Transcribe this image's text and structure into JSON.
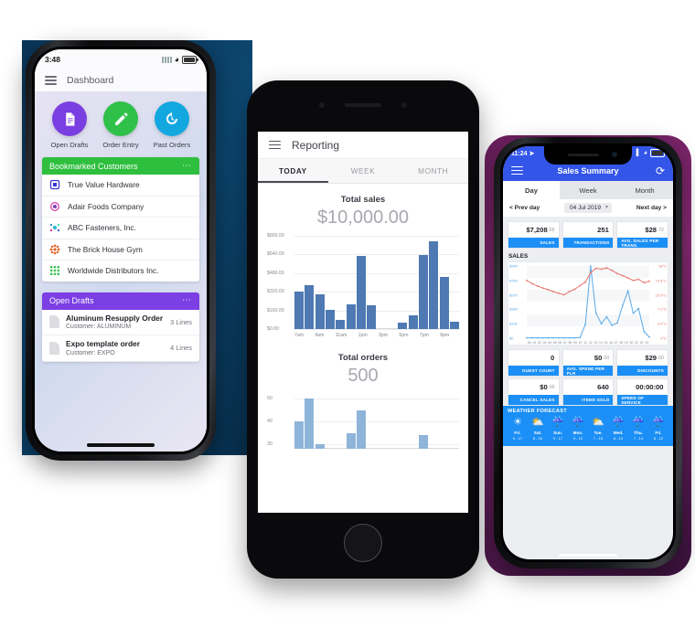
{
  "phone1": {
    "status": {
      "time": "3:48",
      "wifi_icon": "wifi-icon",
      "battery_icon": "battery-icon",
      "signal_icon": "signal-icon"
    },
    "appbar": {
      "menu_icon": "hamburger-menu-icon",
      "title": "Dashboard"
    },
    "actions": [
      {
        "label": "Open Drafts",
        "color": "#7a3fe0",
        "icon": "document-icon"
      },
      {
        "label": "Order Entry",
        "color": "#2fc04a",
        "icon": "pencil-icon"
      },
      {
        "label": "Past Orders",
        "color": "#13a7e0",
        "icon": "history-icon"
      }
    ],
    "bookmarked": {
      "title": "Bookmarked Customers",
      "color": "#2fbf3f",
      "overflow_icon": "more-options-icon",
      "customers": [
        {
          "name": "True Value Hardware",
          "color": "#3a35d8"
        },
        {
          "name": "Adair Foods Company",
          "color": "#d93fb0"
        },
        {
          "name": "ABC Fasteners, Inc.",
          "color": "#2fb7d8"
        },
        {
          "name": "The Brick House Gym",
          "color": "#e06428"
        },
        {
          "name": "Worldwide Distributors Inc.",
          "color": "#3fc45a"
        }
      ]
    },
    "drafts": {
      "title": "Open Drafts",
      "color": "#7b3fe4",
      "overflow_icon": "more-options-icon",
      "items": [
        {
          "title": "Aluminum Resupply Order",
          "subtitle": "Customer: ALUMINUM",
          "lines": "3 Lines"
        },
        {
          "title": "Expo template order",
          "subtitle": "Customer: EXPO",
          "lines": "4 Lines"
        }
      ]
    }
  },
  "phone2": {
    "appbar": {
      "menu_icon": "hamburger-menu-icon",
      "title": "Reporting"
    },
    "tabs": [
      {
        "label": "TODAY",
        "active": true
      },
      {
        "label": "WEEK",
        "active": false
      },
      {
        "label": "MONTH",
        "active": false
      }
    ],
    "sales_title": "Total sales",
    "sales_value": "$10,000.00",
    "orders_title": "Total orders",
    "orders_value": "500"
  },
  "phone3": {
    "status": {
      "time": "11:24",
      "location_icon": "location-arrow-icon",
      "signal_icon": "signal-icon",
      "wifi_icon": "wifi-icon",
      "battery_icon": "battery-icon"
    },
    "appbar": {
      "menu_icon": "hamburger-menu-icon",
      "title": "Sales Summary",
      "refresh_icon": "refresh-icon"
    },
    "segments": [
      {
        "label": "Day",
        "active": true
      },
      {
        "label": "Week",
        "active": false
      },
      {
        "label": "Month",
        "active": false
      }
    ],
    "daynav": {
      "prev": "< Prev day",
      "date": "04 Jul 2019",
      "next": "Next day >",
      "dropdown_icon": "chevron-down-icon"
    },
    "tiles_top": [
      {
        "value": "$7,208",
        "cents": ".65",
        "key": "SALES"
      },
      {
        "value": "251",
        "cents": "",
        "key": "TRANSACTIONS"
      },
      {
        "value": "$28",
        "cents": ".72",
        "key": "AVG. SALES PER TRANS."
      }
    ],
    "tiles_bottom": [
      {
        "value": "0",
        "cents": "",
        "key": "GUEST COUNT"
      },
      {
        "value": "$0",
        "cents": ".00",
        "key": "AVG. SPEND PER PLR"
      },
      {
        "value": "$29",
        "cents": ".00",
        "key": "DISCOUNTS"
      },
      {
        "value": "$0",
        "cents": ".00",
        "key": "CANCEL SALES"
      },
      {
        "value": "640",
        "cents": "",
        "key": "ITEMS SOLD"
      },
      {
        "value": "00:00:00",
        "cents": "",
        "key": "SPEED OF SERVICE"
      }
    ],
    "sales_section": "SALES",
    "weather_title": "WEATHER FORECAST",
    "weather": [
      {
        "day": "Fri.",
        "temps": "5 - 17",
        "icon": "sun-icon"
      },
      {
        "day": "Sat.",
        "temps": "8 - 18",
        "icon": "partly-cloudy-icon"
      },
      {
        "day": "Sun.",
        "temps": "9 - 17",
        "icon": "rain-icon"
      },
      {
        "day": "Mon.",
        "temps": "9 - 15",
        "icon": "rain-icon"
      },
      {
        "day": "Tue.",
        "temps": "7 - 15",
        "icon": "partly-cloudy-icon"
      },
      {
        "day": "Wed.",
        "temps": "8 - 13",
        "icon": "rain-icon"
      },
      {
        "day": "Thu.",
        "temps": "7 - 14",
        "icon": "rain-icon"
      },
      {
        "day": "Fri.",
        "temps": "8 - 12",
        "icon": "rain-icon"
      }
    ]
  },
  "chart_data": [
    {
      "type": "bar",
      "title": "Total sales",
      "subtitle": "$10,000.00",
      "xlabel": "",
      "ylabel": "",
      "ylim": [
        0,
        800
      ],
      "ytick_labels": [
        "$0.00",
        "$160.00",
        "$320.00",
        "$480.00",
        "$640.00",
        "$800.00"
      ],
      "ytick_values": [
        0,
        160,
        320,
        480,
        640,
        800
      ],
      "grid": true,
      "categories": [
        "7am",
        "8am",
        "9am",
        "10am",
        "11am",
        "12pm",
        "1pm",
        "2pm",
        "3pm",
        "4pm",
        "5pm",
        "6pm",
        "7pm",
        "8pm",
        "9pm",
        "10pm"
      ],
      "xtick_labels": [
        "7am",
        "",
        "9am",
        "",
        "11am",
        "",
        "1pm",
        "",
        "3pm",
        "",
        "5pm",
        "",
        "7pm",
        "",
        "9pm",
        ""
      ],
      "values": [
        320,
        375,
        300,
        165,
        80,
        215,
        625,
        205,
        0,
        0,
        55,
        120,
        635,
        750,
        450,
        65
      ],
      "color": "#4e79b2"
    },
    {
      "type": "bar",
      "title": "Total orders",
      "subtitle": "500",
      "xlabel": "",
      "ylabel": "",
      "ylim": [
        28,
        52
      ],
      "ytick_labels": [
        "30",
        "40",
        "50"
      ],
      "ytick_values": [
        30,
        40,
        50
      ],
      "grid": true,
      "categories": [
        "7am",
        "8am",
        "9am",
        "10am",
        "11am",
        "12pm",
        "1pm",
        "2pm",
        "3pm",
        "4pm",
        "5pm",
        "6pm",
        "7pm",
        "8pm",
        "9pm",
        "10pm"
      ],
      "values": [
        40,
        50,
        30,
        0,
        0,
        35,
        45,
        0,
        0,
        0,
        0,
        0,
        34,
        0,
        0,
        0
      ],
      "color": "#8fb4d9"
    },
    {
      "type": "line",
      "title": "SALES",
      "xlabel": "",
      "ylabel": "",
      "grid": true,
      "y_left_ticks": [
        "$0",
        "$190",
        "$380",
        "$570",
        "$760",
        "$950"
      ],
      "y_left_values": [
        0,
        190,
        380,
        570,
        760,
        950
      ],
      "y_right_ticks": [
        "0°C",
        "3.6°C",
        "7.2°C",
        "10.8°C",
        "14.4°C",
        "18°C"
      ],
      "y_right_values": [
        0,
        3.6,
        7.2,
        10.8,
        14.4,
        18
      ],
      "x": [
        "00",
        "01",
        "02",
        "03",
        "04",
        "05",
        "06",
        "07",
        "08",
        "09",
        "10",
        "11",
        "12",
        "13",
        "14",
        "15",
        "16",
        "17",
        "18",
        "19",
        "20",
        "21",
        "22",
        "23"
      ],
      "series": [
        {
          "name": "Sales",
          "color": "#5aa9e6",
          "axis": "left",
          "values": [
            5,
            5,
            5,
            5,
            5,
            5,
            5,
            5,
            5,
            5,
            8,
            180,
            945,
            330,
            190,
            280,
            170,
            200,
            430,
            620,
            330,
            390,
            90,
            15
          ]
        },
        {
          "name": "Temperature",
          "color": "#e8746b",
          "axis": "right",
          "values": [
            14.4,
            13.6,
            13.0,
            12.5,
            12.1,
            11.6,
            11.2,
            10.8,
            11.6,
            12.2,
            13.1,
            14.0,
            16.3,
            17.4,
            17.2,
            17.5,
            16.9,
            16.1,
            15.6,
            15.0,
            14.4,
            14.7,
            13.8,
            14.2
          ]
        }
      ]
    }
  ]
}
